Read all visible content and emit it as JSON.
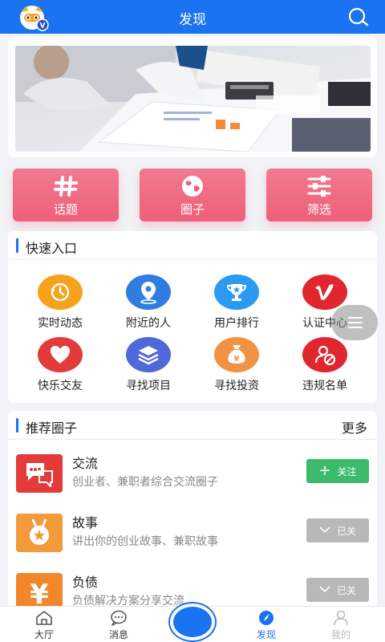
{
  "header": {
    "title": "发现"
  },
  "big_buttons": [
    {
      "label": "话题",
      "icon": "hashtag-icon"
    },
    {
      "label": "圈子",
      "icon": "globe-icon"
    },
    {
      "label": "筛选",
      "icon": "filter-sliders-icon"
    }
  ],
  "quick_entry": {
    "title": "快速入口",
    "items": [
      {
        "label": "实时动态",
        "icon": "clock-history-icon",
        "color": "#f7a21b"
      },
      {
        "label": "附近的人",
        "icon": "location-pin-icon",
        "color": "#2f7de1"
      },
      {
        "label": "用户排行",
        "icon": "trophy-icon",
        "color": "#2a9af3"
      },
      {
        "label": "认证中心",
        "icon": "vimeo-v-icon",
        "color": "#e0262f"
      },
      {
        "label": "快乐交友",
        "icon": "heart-icon",
        "color": "#e23b3b"
      },
      {
        "label": "寻找项目",
        "icon": "layers-icon",
        "color": "#4f68da"
      },
      {
        "label": "寻找投资",
        "icon": "money-bag-icon",
        "color": "#f29245"
      },
      {
        "label": "违规名单",
        "icon": "user-ban-icon",
        "color": "#e0262f"
      }
    ]
  },
  "recommend": {
    "title": "推荐圈子",
    "more": "更多",
    "items": [
      {
        "name": "交流",
        "desc": "创业者、兼职者综合交流圈子",
        "button": "关注",
        "followed": false,
        "color": "#e33a3a"
      },
      {
        "name": "故事",
        "desc": "讲出你的创业故事、兼职故事",
        "button": "已关",
        "followed": true,
        "color": "#f39a3b"
      },
      {
        "name": "负债",
        "desc": "负债解决方案分享交流",
        "button": "已关",
        "followed": true,
        "color": "#f2862b"
      }
    ]
  },
  "nav": {
    "items": [
      {
        "label": "大厅"
      },
      {
        "label": "消息"
      },
      {
        "label": "发现"
      },
      {
        "label": "我的"
      }
    ]
  }
}
